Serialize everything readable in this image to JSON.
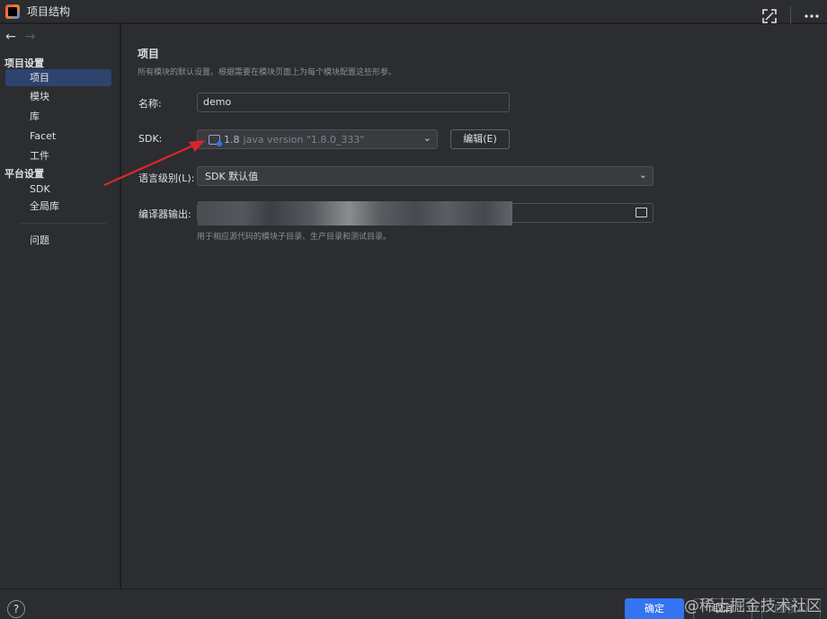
{
  "window": {
    "title": "项目结构"
  },
  "sidebar": {
    "project_settings": "项目设置",
    "project_items": [
      "项目",
      "模块",
      "库",
      "Facet",
      "工件"
    ],
    "platform_settings": "平台设置",
    "platform_items": [
      "SDK",
      "全局库"
    ],
    "problems": "问题"
  },
  "main": {
    "heading": "项目",
    "subheading": "所有模块的默认设置。根据需要在模块页面上为每个模块配置这些形参。",
    "name_label": "名称:",
    "name_value": "demo",
    "sdk_label": "SDK:",
    "sdk_version": "1.8",
    "sdk_detail": "java version \"1.8.0_333\"",
    "edit_button": "编辑(E)",
    "language_level_label": "语言级别(L):",
    "language_level_value": "SDK 默认值",
    "compiler_output_label": "编译器输出:",
    "compiler_output_hint": "用于相应源代码的模块子目录、生产目录和测试目录。"
  },
  "footer": {
    "help": "?",
    "ok": "确定",
    "cancel": "取消",
    "apply": "应用(A)",
    "watermark": "@稀土掘金技术社区"
  },
  "colors": {
    "accent": "#3574f0",
    "selection": "#2e436e",
    "annotation_arrow": "#d9262c"
  },
  "icons": [
    "back-arrow-icon",
    "forward-arrow-icon",
    "expand-icon",
    "more-icon",
    "sdk-folder-icon",
    "chevron-down-icon",
    "folder-icon",
    "help-icon"
  ]
}
